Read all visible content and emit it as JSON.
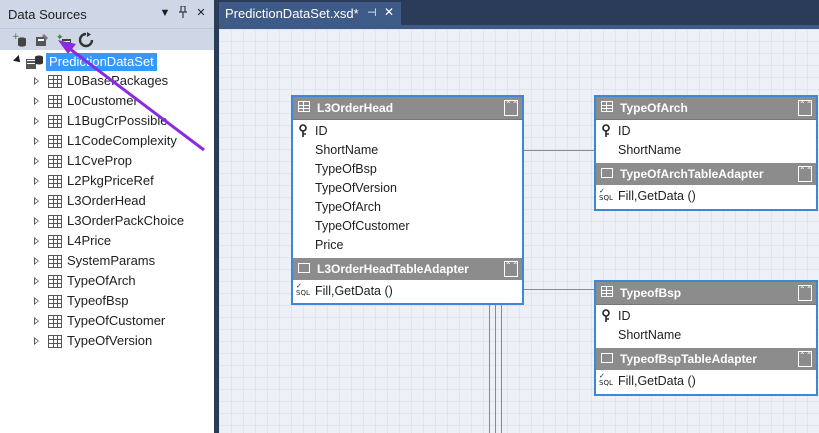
{
  "panel": {
    "title": "Data Sources",
    "dropdown_glyph": "▼",
    "pin_glyph": "⊞",
    "close_glyph": "✕",
    "toolbar": [
      {
        "name": "add-data-source-icon"
      },
      {
        "name": "edit-dataset-icon"
      },
      {
        "name": "configure-dataset-icon"
      },
      {
        "name": "refresh-icon"
      }
    ]
  },
  "tree": {
    "root": "PredictionDataSet",
    "items": [
      "L0BasePackages",
      "L0Customer",
      "L1BugCrPossible",
      "L1CodeComplexity",
      "L1CveProp",
      "L2PkgPriceRef",
      "L3OrderHead",
      "L3OrderPackChoice",
      "L4Price",
      "SystemParams",
      "TypeOfArch",
      "TypeofBsp",
      "TypeOfCustomer",
      "TypeOfVersion"
    ]
  },
  "document": {
    "tab_label": "PredictionDataSet.xsd*",
    "tab_pin": "⊣",
    "tab_close": "✕"
  },
  "tables": {
    "l3orderhead": {
      "title": "L3OrderHead",
      "columns": [
        "ID",
        "ShortName",
        "TypeOfBsp",
        "TypeOfVersion",
        "TypeOfArch",
        "TypeOfCustomer",
        "Price"
      ],
      "adapter": "L3OrderHeadTableAdapter",
      "query": "Fill,GetData ()"
    },
    "typeofarch": {
      "title": "TypeOfArch",
      "columns": [
        "ID",
        "ShortName"
      ],
      "adapter": "TypeOfArchTableAdapter",
      "query": "Fill,GetData ()"
    },
    "typeofbsp": {
      "title": "TypeofBsp",
      "columns": [
        "ID",
        "ShortName"
      ],
      "adapter": "TypeofBspTableAdapter",
      "query": "Fill,GetData ()"
    }
  },
  "glyphs": {
    "key": "🔑",
    "collapse": "⌃⌃",
    "sql_check": "✓",
    "sql_text": "SQL"
  },
  "colors": {
    "accent": "#3e86d6",
    "selection": "#3399ff",
    "header_gray": "#8c8c8c",
    "annotation_arrow": "#8a2be2"
  }
}
